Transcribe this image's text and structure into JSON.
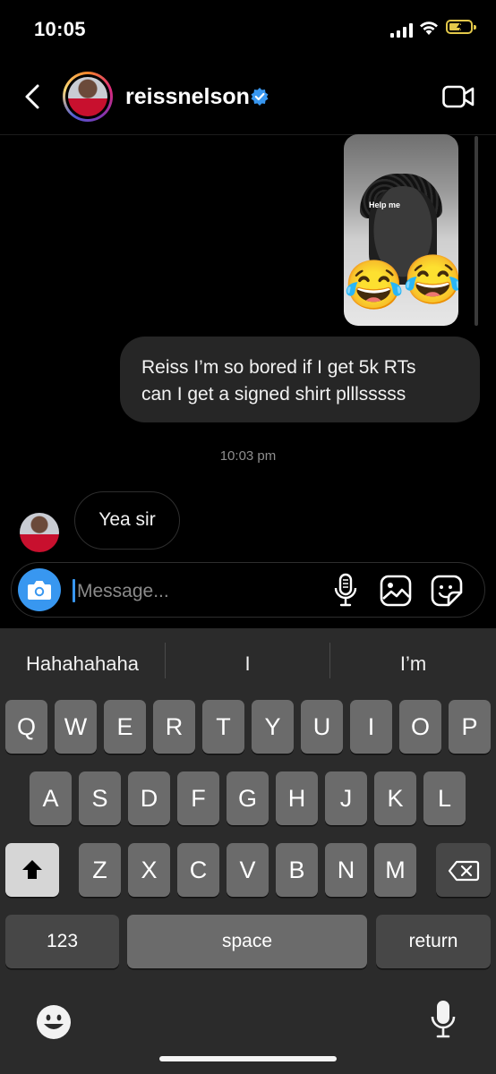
{
  "status_bar": {
    "time": "10:05"
  },
  "header": {
    "username": "reissnelson",
    "verified": true
  },
  "conversation": {
    "story_reply_text": "Help me",
    "story_emojis": [
      "😂",
      "😂"
    ],
    "outgoing_message": [
      "Reiss I’m so bored if I get 5k RTs",
      "can I get a signed shirt plllsssss"
    ],
    "timestamp": "10:03 pm",
    "incoming_message": "Yea sir"
  },
  "composer": {
    "placeholder": "Message..."
  },
  "keyboard": {
    "suggestions": [
      "Hahahahaha",
      "I",
      "I’m"
    ],
    "row1": [
      "Q",
      "W",
      "E",
      "R",
      "T",
      "Y",
      "U",
      "I",
      "O",
      "P"
    ],
    "row2": [
      "A",
      "S",
      "D",
      "F",
      "G",
      "H",
      "J",
      "K",
      "L"
    ],
    "row3": [
      "Z",
      "X",
      "C",
      "V",
      "B",
      "N",
      "M"
    ],
    "numbers_key": "123",
    "space_key": "space",
    "return_key": "return"
  },
  "colors": {
    "accent": "#3897f0",
    "bubble_out": "#262626",
    "keyboard_bg": "#2b2b2b",
    "battery": "#e3c84a"
  },
  "icons": [
    "back-arrow-icon",
    "verified-badge-icon",
    "video-call-icon",
    "camera-icon",
    "microphone-icon",
    "gallery-icon",
    "sticker-icon",
    "shift-icon",
    "backspace-icon",
    "emoji-icon",
    "dictation-icon"
  ]
}
